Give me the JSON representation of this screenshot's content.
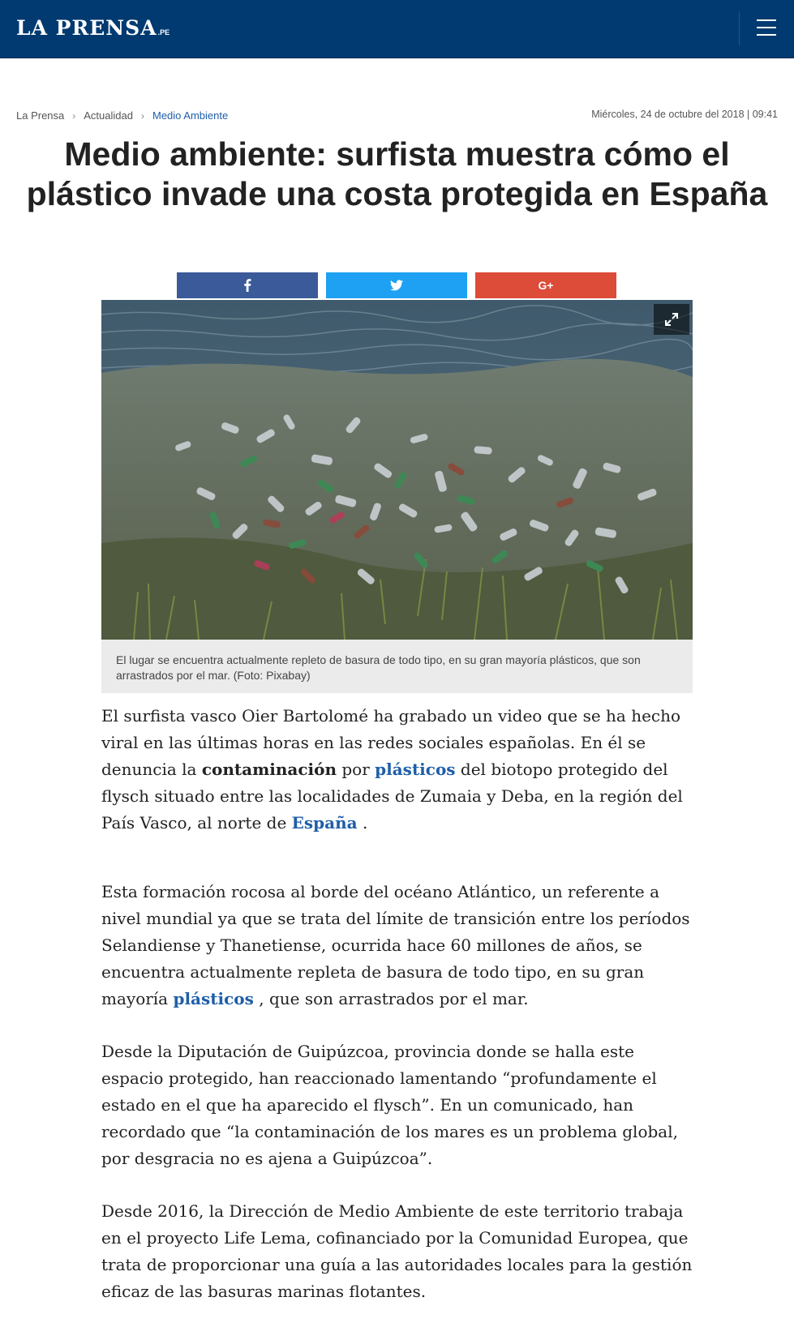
{
  "header": {
    "logo_text": "LA PRENSA",
    "logo_suffix": ".PE",
    "menu_icon": "hamburger-menu-icon",
    "bg_color": "#003a70"
  },
  "breadcrumb": {
    "items": [
      "La Prensa",
      "Actualidad",
      "Medio Ambiente"
    ],
    "separator": "›"
  },
  "date": "Miércoles, 24 de octubre del 2018 | 09:41",
  "article": {
    "title": "Medio ambiente: surfista muestra cómo el plástico invade una costa protegida en España",
    "share": [
      {
        "network": "facebook",
        "icon": "facebook-icon",
        "color": "#3b5a9a"
      },
      {
        "network": "twitter",
        "icon": "twitter-icon",
        "color": "#1ea1f2"
      },
      {
        "network": "google-plus",
        "icon": "google-plus-icon",
        "label": "G+",
        "color": "#dd4b39"
      }
    ],
    "image": {
      "expand_icon": "expand-icon",
      "caption": "El lugar se encuentra actualmente repleto de basura de todo tipo, en su gran mayoría plásticos, que son arrastrados por el mar. (Foto: Pixabay)"
    },
    "paragraphs": {
      "p1": {
        "t1": "El surfista vasco Oier Bartolomé ha grabado un video que se ha hecho viral en las últimas horas en las redes sociales españolas. En él se denuncia la ",
        "bold": "contaminación",
        "t2": " por ",
        "link1": "plásticos",
        "t3": " del biotopo protegido del flysch situado entre las localidades de Zumaia y Deba, en la región del País Vasco, al norte de ",
        "link2": "España",
        "t4": " ."
      },
      "p2": {
        "t1": "Esta formación rocosa al borde del océano Atlántico, un referente a nivel mundial ya que se trata del límite de transición entre los períodos Selandiense y Thanetiense, ocurrida hace 60 millones de años, se encuentra actualmente repleta de basura de todo tipo, en su gran mayoría ",
        "link1": "plásticos",
        "t2": " , que son arrastrados por el mar."
      },
      "p3": "Desde la Diputación de Guipúzcoa, provincia donde se halla este espacio protegido, han reaccionado lamentando “profundamente el estado en el que ha aparecido el flysch”. En un comunicado, han recordado que “la contaminación de los mares es un problema global, por desgracia no es ajena a Guipúzcoa”.",
      "p4": "Desde 2016, la Dirección de Medio Ambiente de este territorio trabaja en el proyecto Life Lema, cofinanciado por la Comunidad Europea, que trata de proporcionar una guía a las autoridades locales para la gestión eficaz de las basuras marinas flotantes."
    },
    "link_color": "#1f5ea8"
  }
}
